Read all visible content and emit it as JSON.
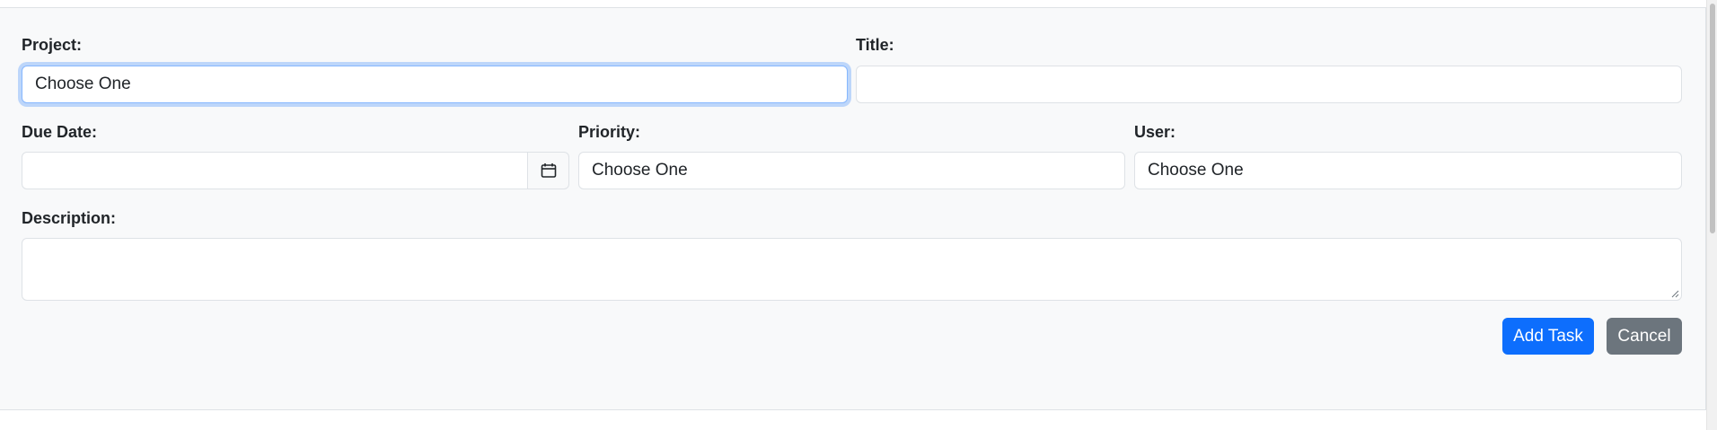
{
  "form": {
    "project": {
      "label": "Project:",
      "value": "Choose One"
    },
    "title": {
      "label": "Title:",
      "value": ""
    },
    "due_date": {
      "label": "Due Date:",
      "value": ""
    },
    "priority": {
      "label": "Priority:",
      "value": "Choose One"
    },
    "user": {
      "label": "User:",
      "value": "Choose One"
    },
    "description": {
      "label": "Description:",
      "value": ""
    }
  },
  "actions": {
    "add_task": "Add Task",
    "cancel": "Cancel"
  },
  "icons": {
    "date_picker": "calendar-icon"
  },
  "colors": {
    "panel_bg": "#f8f9fa",
    "primary": "#0d6efd",
    "secondary": "#6c757d",
    "focus_ring": "#86b7fe"
  }
}
